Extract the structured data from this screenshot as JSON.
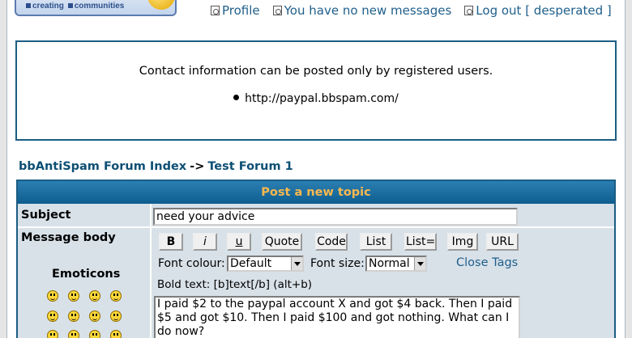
{
  "header": {
    "logo_text_1": "creating",
    "logo_text_2": "communities",
    "nav": [
      {
        "label": "Profile",
        "icon": "profile-icon"
      },
      {
        "label": "You have no new messages",
        "icon": "messages-icon"
      },
      {
        "label": "Log out [ desperated ]",
        "icon": "logout-icon"
      }
    ]
  },
  "contact": {
    "message": "Contact information can be posted only by registered users.",
    "link": "http://paypal.bbspam.com/"
  },
  "breadcrumb": {
    "forum_index": "bbAntiSpam Forum Index",
    "separator": "->",
    "forum": "Test Forum 1"
  },
  "post_form": {
    "header": "Post a new topic",
    "subject_label": "Subject",
    "subject_value": "need your advice",
    "message_body_label": "Message body",
    "emoticons_label": "Emoticons",
    "toolbar": {
      "bold": "B",
      "italic": "i",
      "underline": "u",
      "quote": "Quote",
      "code": "Code",
      "list": "List",
      "list_eq": "List=",
      "img": "Img",
      "url": "URL"
    },
    "font_colour_label": "Font colour:",
    "font_colour_value": "Default",
    "font_size_label": "Font size:",
    "font_size_value": "Normal",
    "close_tags": "Close Tags",
    "help_text": "Bold text: [b]text[/b]  (alt+b)",
    "message_value": "I paid $2 to the paypal account X and got $4 back. Then I paid $5 and got $10. Then I paid $100 and got nothing. What can I do now?"
  },
  "colors": {
    "accent": "#1b5d84",
    "header_text": "#f8b84e",
    "link": "#1f5f8b",
    "panel_bg": "#d8e1e8"
  }
}
